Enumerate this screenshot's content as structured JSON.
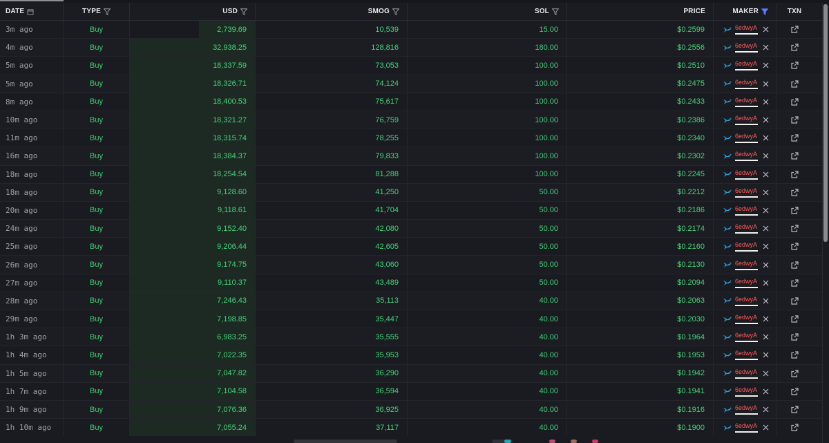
{
  "headers": {
    "date": "DATE",
    "type": "TYPE",
    "usd": "USD",
    "smog": "SMOG",
    "sol": "SOL",
    "price": "PRICE",
    "maker": "MAKER",
    "txn": "TXN"
  },
  "icons": {
    "date_sort": "calendar-icon",
    "filter": "filter-icon",
    "maker_filter_active": "filter-icon",
    "whale": "whale-icon",
    "remove": "close-icon",
    "open_txn": "external-link-icon"
  },
  "colors": {
    "buy": "#3fcf72",
    "maker": "#ff5a5a",
    "active_filter": "#5b7cff"
  },
  "rows": [
    {
      "date": "3m ago",
      "type": "Buy",
      "usd": "2,739.69",
      "usd_share": 0.45,
      "smog": "10,539",
      "sol": "15.00",
      "price": "$0.2599",
      "maker": "6edwyA"
    },
    {
      "date": "4m ago",
      "type": "Buy",
      "usd": "32,938.25",
      "usd_share": 1.0,
      "smog": "128,816",
      "sol": "180.00",
      "price": "$0.2556",
      "maker": "6edwyA"
    },
    {
      "date": "5m ago",
      "type": "Buy",
      "usd": "18,337.59",
      "usd_share": 1.0,
      "smog": "73,053",
      "sol": "100.00",
      "price": "$0.2510",
      "maker": "6edwyA"
    },
    {
      "date": "5m ago",
      "type": "Buy",
      "usd": "18,326.71",
      "usd_share": 1.0,
      "smog": "74,124",
      "sol": "100.00",
      "price": "$0.2475",
      "maker": "6edwyA"
    },
    {
      "date": "8m ago",
      "type": "Buy",
      "usd": "18,400.53",
      "usd_share": 1.0,
      "smog": "75,617",
      "sol": "100.00",
      "price": "$0.2433",
      "maker": "6edwyA"
    },
    {
      "date": "10m ago",
      "type": "Buy",
      "usd": "18,321.27",
      "usd_share": 1.0,
      "smog": "76,759",
      "sol": "100.00",
      "price": "$0.2386",
      "maker": "6edwyA"
    },
    {
      "date": "11m ago",
      "type": "Buy",
      "usd": "18,315.74",
      "usd_share": 1.0,
      "smog": "78,255",
      "sol": "100.00",
      "price": "$0.2340",
      "maker": "6edwyA"
    },
    {
      "date": "16m ago",
      "type": "Buy",
      "usd": "18,384.37",
      "usd_share": 1.0,
      "smog": "79,833",
      "sol": "100.00",
      "price": "$0.2302",
      "maker": "6edwyA"
    },
    {
      "date": "18m ago",
      "type": "Buy",
      "usd": "18,254.54",
      "usd_share": 1.0,
      "smog": "81,288",
      "sol": "100.00",
      "price": "$0.2245",
      "maker": "6edwyA"
    },
    {
      "date": "18m ago",
      "type": "Buy",
      "usd": "9,128.60",
      "usd_share": 1.0,
      "smog": "41,250",
      "sol": "50.00",
      "price": "$0.2212",
      "maker": "6edwyA"
    },
    {
      "date": "20m ago",
      "type": "Buy",
      "usd": "9,118.61",
      "usd_share": 1.0,
      "smog": "41,704",
      "sol": "50.00",
      "price": "$0.2186",
      "maker": "6edwyA"
    },
    {
      "date": "24m ago",
      "type": "Buy",
      "usd": "9,152.40",
      "usd_share": 1.0,
      "smog": "42,080",
      "sol": "50.00",
      "price": "$0.2174",
      "maker": "6edwyA"
    },
    {
      "date": "25m ago",
      "type": "Buy",
      "usd": "9,206.44",
      "usd_share": 1.0,
      "smog": "42,605",
      "sol": "50.00",
      "price": "$0.2160",
      "maker": "6edwyA"
    },
    {
      "date": "26m ago",
      "type": "Buy",
      "usd": "9,174.75",
      "usd_share": 1.0,
      "smog": "43,060",
      "sol": "50.00",
      "price": "$0.2130",
      "maker": "6edwyA"
    },
    {
      "date": "27m ago",
      "type": "Buy",
      "usd": "9,110.37",
      "usd_share": 1.0,
      "smog": "43,489",
      "sol": "50.00",
      "price": "$0.2094",
      "maker": "6edwyA"
    },
    {
      "date": "28m ago",
      "type": "Buy",
      "usd": "7,246.43",
      "usd_share": 1.0,
      "smog": "35,113",
      "sol": "40.00",
      "price": "$0.2063",
      "maker": "6edwyA"
    },
    {
      "date": "29m ago",
      "type": "Buy",
      "usd": "7,198.85",
      "usd_share": 1.0,
      "smog": "35,447",
      "sol": "40.00",
      "price": "$0.2030",
      "maker": "6edwyA"
    },
    {
      "date": "1h 3m ago",
      "type": "Buy",
      "usd": "6,983.25",
      "usd_share": 1.0,
      "smog": "35,555",
      "sol": "40.00",
      "price": "$0.1964",
      "maker": "6edwyA"
    },
    {
      "date": "1h 4m ago",
      "type": "Buy",
      "usd": "7,022.35",
      "usd_share": 1.0,
      "smog": "35,953",
      "sol": "40.00",
      "price": "$0.1953",
      "maker": "6edwyA"
    },
    {
      "date": "1h 5m ago",
      "type": "Buy",
      "usd": "7,047.82",
      "usd_share": 1.0,
      "smog": "36,290",
      "sol": "40.00",
      "price": "$0.1942",
      "maker": "6edwyA"
    },
    {
      "date": "1h 7m ago",
      "type": "Buy",
      "usd": "7,104.58",
      "usd_share": 1.0,
      "smog": "36,594",
      "sol": "40.00",
      "price": "$0.1941",
      "maker": "6edwyA"
    },
    {
      "date": "1h 9m ago",
      "type": "Buy",
      "usd": "7,076.36",
      "usd_share": 1.0,
      "smog": "36,925",
      "sol": "40.00",
      "price": "$0.1916",
      "maker": "6edwyA"
    },
    {
      "date": "1h 10m ago",
      "type": "Buy",
      "usd": "7,055.24",
      "usd_share": 1.0,
      "smog": "37,117",
      "sol": "40.00",
      "price": "$0.1900",
      "maker": "6edwyA"
    }
  ]
}
